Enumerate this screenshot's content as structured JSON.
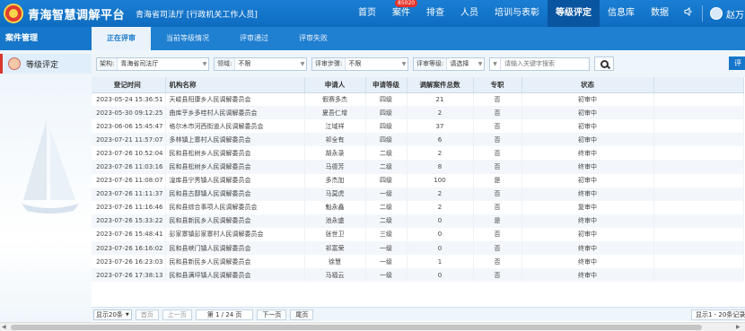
{
  "header": {
    "app_title": "青海智慧调解平台",
    "org_title": "青海省司法厅 [行政机关工作人员]",
    "nav": [
      {
        "label": "首页",
        "active": false
      },
      {
        "label": "案件",
        "active": false,
        "badge": "85020"
      },
      {
        "label": "排查",
        "active": false
      },
      {
        "label": "人员",
        "active": false
      },
      {
        "label": "培训与表彰",
        "active": false
      },
      {
        "label": "等级评定",
        "active": true
      },
      {
        "label": "信息库",
        "active": false
      },
      {
        "label": "数据",
        "active": false
      }
    ],
    "user_name": "赵万",
    "speaker_icon": "speaker-icon"
  },
  "sidebar": {
    "title": "案件管理",
    "items": [
      {
        "label": "等级评定",
        "icon": "user-avatar-icon"
      }
    ]
  },
  "tabs": [
    {
      "label": "正在评审",
      "active": true
    },
    {
      "label": "当前等级情况",
      "active": false
    },
    {
      "label": "评审通过",
      "active": false
    },
    {
      "label": "评审失败",
      "active": false
    }
  ],
  "filter": {
    "org_label": "架构:",
    "org_value": "青海省司法厅",
    "field_label": "领域:",
    "field_value": "不限",
    "step_label": "评审步骤:",
    "step_value": "不限",
    "level_label": "评审等级:",
    "level_value": "请选择",
    "search_placeholder": "请输入关键字搜索",
    "eval_button": "评"
  },
  "table": {
    "columns": {
      "time": "登记时间",
      "org": "机构名称",
      "applicant": "申请人",
      "level": "申请等级",
      "total": "调解案件总数",
      "fulltime": "专职",
      "status": "状态"
    },
    "rows": [
      {
        "time": "2023-05-24 15:36:51",
        "org": "天峻县阳康乡人民调解委员会",
        "applicant": "假赛多杰",
        "level": "四级",
        "total": "21",
        "fulltime": "否",
        "status": "初审中"
      },
      {
        "time": "2023-05-30 09:12:25",
        "org": "曲库乎乡多哇村人民调解委员会",
        "applicant": "夏吾仁增",
        "level": "四级",
        "total": "2",
        "fulltime": "否",
        "status": "初审中"
      },
      {
        "time": "2023-06-06 15:45:47",
        "org": "格尔木市河西街道人民调解委员会",
        "applicant": "江域祥",
        "level": "四级",
        "total": "37",
        "fulltime": "否",
        "status": "初审中"
      },
      {
        "time": "2023-07-21 11:57:07",
        "org": "多林镇上寨村人民调解委员会",
        "applicant": "祁全有",
        "level": "四级",
        "total": "6",
        "fulltime": "否",
        "status": "初审中"
      },
      {
        "time": "2023-07-26 10:52:04",
        "org": "民和县松树乡人民调解委员会",
        "applicant": "胡永录",
        "level": "二级",
        "total": "2",
        "fulltime": "否",
        "status": "终审中"
      },
      {
        "time": "2023-07-26 11:03:16",
        "org": "民和县松树乡人民调解委员会",
        "applicant": "马德芳",
        "level": "二级",
        "total": "8",
        "fulltime": "否",
        "status": "终审中"
      },
      {
        "time": "2023-07-26 11:08:07",
        "org": "湟库县宁秀镇人民调解委员会",
        "applicant": "多杰加",
        "level": "四级",
        "total": "100",
        "fulltime": "是",
        "status": "初审中"
      },
      {
        "time": "2023-07-26 11:11:37",
        "org": "民和县古鄯镇人民调解委员会",
        "applicant": "马莫虎",
        "level": "一级",
        "total": "2",
        "fulltime": "否",
        "status": "终审中"
      },
      {
        "time": "2023-07-26 11:16:46",
        "org": "民和县综合事项人民调解委员会",
        "applicant": "魁永鑫",
        "level": "二级",
        "total": "2",
        "fulltime": "否",
        "status": "复审中"
      },
      {
        "time": "2023-07-26 15:33:22",
        "org": "民和县新民乡人民调解委员会",
        "applicant": "池永盛",
        "level": "二级",
        "total": "0",
        "fulltime": "是",
        "status": "终审中"
      },
      {
        "time": "2023-07-26 15:48:41",
        "org": "彭家寨镇彭家寨村人民调解委员会",
        "applicant": "张世卫",
        "level": "三级",
        "total": "0",
        "fulltime": "否",
        "status": "初审中"
      },
      {
        "time": "2023-07-26 16:16:02",
        "org": "民和县峡门镇人民调解委员会",
        "applicant": "祁富荣",
        "level": "一级",
        "total": "0",
        "fulltime": "否",
        "status": "终审中"
      },
      {
        "time": "2023-07-26 16:23:03",
        "org": "民和县新民乡人民调解委员会",
        "applicant": "徐慧",
        "level": "一级",
        "total": "1",
        "fulltime": "否",
        "status": "终审中"
      },
      {
        "time": "2023-07-26 17:38:13",
        "org": "民和县满坪镇人民调解委员会",
        "applicant": "马福云",
        "level": "一级",
        "total": "0",
        "fulltime": "否",
        "status": "终审中"
      }
    ]
  },
  "pager": {
    "page_size": "显示20条",
    "first": "首页",
    "prev": "上一页",
    "page_info": "第 1 / 24 页",
    "next": "下一页",
    "last": "尾页",
    "count_info": "显示1 - 20条记录"
  }
}
